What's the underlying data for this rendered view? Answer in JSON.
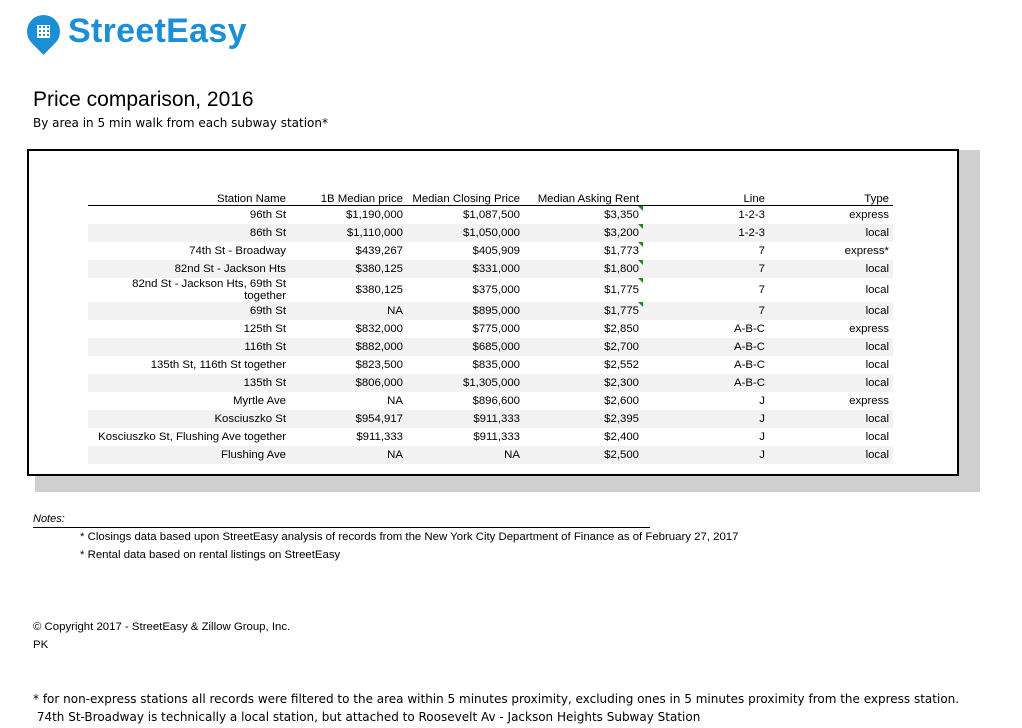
{
  "brand": {
    "name": "StreetEasy",
    "icon": "map-pin-building-icon",
    "color": "#1a8fd6"
  },
  "title": "Price comparison, 2016",
  "subtitle": "By area in 5 min walk from each subway station*",
  "table": {
    "headers": [
      "Station Name",
      "1B Median price",
      "Median Closing Price",
      "Median Asking Rent",
      "Line",
      "Type"
    ],
    "rows": [
      [
        "96th St",
        "$1,190,000",
        "$1,087,500",
        "$3,350",
        "1-2-3",
        "express"
      ],
      [
        "86th St",
        "$1,110,000",
        "$1,050,000",
        "$3,200",
        "1-2-3",
        "local"
      ],
      [
        "74th St - Broadway",
        "$439,267",
        "$405,909",
        "$1,773",
        "7",
        "express*"
      ],
      [
        "82nd St - Jackson Hts",
        "$380,125",
        "$331,000",
        "$1,800",
        "7",
        "local"
      ],
      [
        "82nd St - Jackson Hts, 69th St together",
        "$380,125",
        "$375,000",
        "$1,775",
        "7",
        "local"
      ],
      [
        "69th St",
        "NA",
        "$895,000",
        "$1,775",
        "7",
        "local"
      ],
      [
        "125th St",
        "$832,000",
        "$775,000",
        "$2,850",
        "A-B-C",
        "express"
      ],
      [
        "116th St",
        "$882,000",
        "$685,000",
        "$2,700",
        "A-B-C",
        "local"
      ],
      [
        "135th St, 116th St  together",
        "$823,500",
        "$835,000",
        "$2,552",
        "A-B-C",
        "local"
      ],
      [
        "135th St",
        "$806,000",
        "$1,305,000",
        "$2,300",
        "A-B-C",
        "local"
      ],
      [
        "Myrtle Ave",
        "NA",
        "$896,600",
        "$2,600",
        "J",
        "express"
      ],
      [
        "Kosciuszko St",
        "$954,917",
        "$911,333",
        "$2,395",
        "J",
        "local"
      ],
      [
        "Kosciuszko St, Flushing Ave  together",
        "$911,333",
        "$911,333",
        "$2,400",
        "J",
        "local"
      ],
      [
        "Flushing Ave",
        "NA",
        "NA",
        "$2,500",
        "J",
        "local"
      ]
    ]
  },
  "notes": {
    "label": "Notes:",
    "items": [
      "* Closings data based upon StreetEasy analysis of records from the New York City Department of Finance as of February 27, 2017",
      "* Rental data based on rental listings on StreetEasy"
    ]
  },
  "copyright": "© Copyright 2017 - StreetEasy & Zillow Group, Inc.",
  "author": "PK",
  "footnotes": [
    "* for non-express stations all records were filtered to the area within 5 minutes proximity, excluding ones in 5 minutes proximity from the express station.",
    " 74th St-Broadway is technically a local station, but attached to Roosevelt Av - Jackson Heights Subway Station"
  ]
}
